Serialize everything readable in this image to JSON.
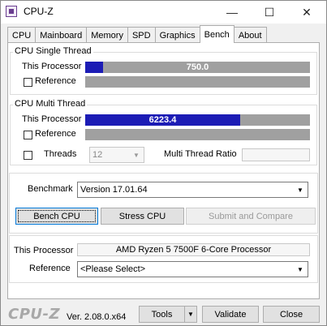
{
  "window": {
    "title": "CPU-Z",
    "controls": {
      "minimize": "—",
      "maximize": "☐",
      "close": "✕"
    }
  },
  "tabs": [
    {
      "label": "CPU"
    },
    {
      "label": "Mainboard"
    },
    {
      "label": "Memory"
    },
    {
      "label": "SPD"
    },
    {
      "label": "Graphics"
    },
    {
      "label": "Bench",
      "active": true
    },
    {
      "label": "About"
    }
  ],
  "single_thread": {
    "legend": "CPU Single Thread",
    "this_processor_label": "This Processor",
    "this_processor_value": "750.0",
    "this_processor_fill": 0.081,
    "reference_label": "Reference"
  },
  "multi_thread": {
    "legend": "CPU Multi Thread",
    "this_processor_label": "This Processor",
    "this_processor_value": "6223.4",
    "this_processor_fill": 0.69,
    "reference_label": "Reference",
    "threads_label": "Threads",
    "threads_value": "12",
    "ratio_label": "Multi Thread Ratio",
    "ratio_value": ""
  },
  "benchmark": {
    "label": "Benchmark",
    "version": "Version 17.01.64",
    "bench_cpu": "Bench CPU",
    "stress_cpu": "Stress CPU",
    "submit": "Submit and Compare"
  },
  "processor": {
    "this_label": "This Processor",
    "this_value": "AMD Ryzen 5 7500F 6-Core Processor",
    "ref_label": "Reference",
    "ref_value": "<Please Select>"
  },
  "footer": {
    "logo": "CPU-Z",
    "version": "Ver. 2.08.0.x64",
    "tools": "Tools",
    "validate": "Validate",
    "close": "Close"
  },
  "colors": {
    "bar_fill": "#1c1cb5",
    "bar_track": "#a0a0a0",
    "logo": "#a8a8a8"
  },
  "icons": {
    "app": "cpu-z-icon",
    "dropdown": "chevron-down-icon"
  }
}
